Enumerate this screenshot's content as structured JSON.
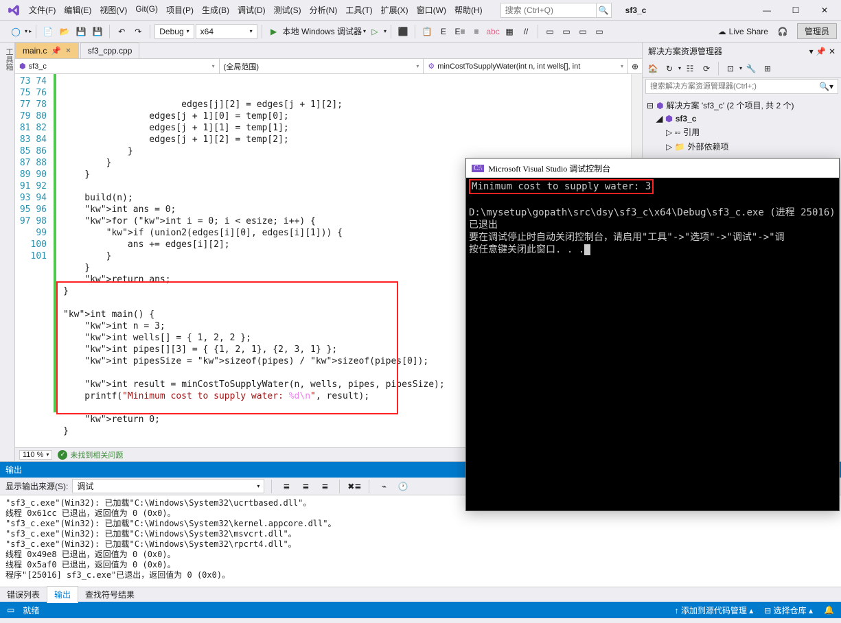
{
  "menu": [
    "文件(F)",
    "编辑(E)",
    "视图(V)",
    "Git(G)",
    "项目(P)",
    "生成(B)",
    "调试(D)",
    "测试(S)",
    "分析(N)",
    "工具(T)",
    "扩展(X)",
    "窗口(W)",
    "帮助(H)"
  ],
  "search_placeholder": "搜索 (Ctrl+Q)",
  "project_name": "sf3_c",
  "toolbar": {
    "config": "Debug",
    "platform": "x64",
    "debug_btn": "本地 Windows 调试器",
    "liveshare": "Live Share",
    "admin": "管理员"
  },
  "sidebar_left": "工具箱",
  "tabs": [
    {
      "label": "main.c",
      "active": true,
      "pinned": true
    },
    {
      "label": "sf3_cpp.cpp",
      "active": false
    }
  ],
  "nav": {
    "left": "sf3_c",
    "mid": "(全局范围)",
    "right": "minCostToSupplyWater(int n, int wells[], int"
  },
  "line_start": 73,
  "line_end": 101,
  "code_lines": [
    "                edges[j][2] = edges[j + 1][2];",
    "                edges[j + 1][0] = temp[0];",
    "                edges[j + 1][1] = temp[1];",
    "                edges[j + 1][2] = temp[2];",
    "            }",
    "        }",
    "    }",
    "",
    "    build(n);",
    "    int ans = 0;",
    "    for (int i = 0; i < esize; i++) {",
    "        if (union2(edges[i][0], edges[i][1])) {",
    "            ans += edges[i][2];",
    "        }",
    "    }",
    "    return ans;",
    "}",
    "",
    "int main() {",
    "    int n = 3;",
    "    int wells[] = { 1, 2, 2 };",
    "    int pipes[][3] = { {1, 2, 1}, {2, 3, 1} };",
    "    int pipesSize = sizeof(pipes) / sizeof(pipes[0]);",
    "",
    "    int result = minCostToSupplyWater(n, wells, pipes, pipesSize);",
    "    printf(\"Minimum cost to supply water: %d\\n\", result);",
    "",
    "    return 0;",
    "}"
  ],
  "zoom": "110 %",
  "status_ok": "未找到相关问题",
  "solution": {
    "title": "解决方案资源管理器",
    "search_placeholder": "搜索解决方案资源管理器(Ctrl+;)",
    "root": "解决方案 'sf3_c' (2 个项目, 共 2 个)",
    "project": "sf3_c",
    "refs": "引用",
    "ext": "外部依赖项"
  },
  "output": {
    "title": "输出",
    "source_label": "显示输出来源(S):",
    "source_value": "调试",
    "lines": [
      "\"sf3_c.exe\"(Win32): 已加载\"C:\\Windows\\System32\\ucrtbased.dll\"。",
      "线程 0x61cc 已退出，返回值为 0 (0x0)。",
      "\"sf3_c.exe\"(Win32): 已加载\"C:\\Windows\\System32\\kernel.appcore.dll\"。",
      "\"sf3_c.exe\"(Win32): 已加载\"C:\\Windows\\System32\\msvcrt.dll\"。",
      "\"sf3_c.exe\"(Win32): 已加载\"C:\\Windows\\System32\\rpcrt4.dll\"。",
      "线程 0x49e8 已退出，返回值为 0 (0x0)。",
      "线程 0x5af0 已退出，返回值为 0 (0x0)。",
      "程序\"[25016] sf3_c.exe\"已退出，返回值为 0 (0x0)。"
    ]
  },
  "bottom_tabs": [
    "错误列表",
    "输出",
    "查找符号结果"
  ],
  "bottom_active": 1,
  "status": {
    "ready": "就绪",
    "scm": "添加到源代码管理",
    "repo": "选择仓库"
  },
  "console": {
    "title": "Microsoft Visual Studio 调试控制台",
    "highlight": "Minimum cost to supply water: 3",
    "line2": "D:\\mysetup\\gopath\\src\\dsy\\sf3_c\\x64\\Debug\\sf3_c.exe (进程 25016)已退出",
    "line3": "要在调试停止时自动关闭控制台，请启用\"工具\"->\"选项\"->\"调试\"->\"调",
    "line4": "按任意键关闭此窗口. . ."
  }
}
